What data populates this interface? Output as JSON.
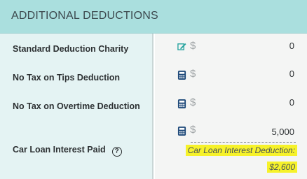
{
  "header": {
    "title": "ADDITIONAL DEDUCTIONS"
  },
  "rows": [
    {
      "label": "Standard Deduction Charity",
      "icon": "edit-icon",
      "currency": "$",
      "value": "0"
    },
    {
      "label": "No Tax on Tips Deduction",
      "icon": "calculator-icon",
      "currency": "$",
      "value": "0"
    },
    {
      "label": "No Tax on Overtime Deduction",
      "icon": "calculator-icon",
      "currency": "$",
      "value": "0"
    },
    {
      "label": "Car Loan Interest Paid",
      "icon": "calculator-icon",
      "currency": "$",
      "value": "5,000",
      "help": "?",
      "note_label": "Car Loan Interest Deduction:",
      "note_value": "$2,600"
    }
  ],
  "colors": {
    "header_bg": "#aadfde",
    "label_bg": "#e4f3f3",
    "highlight": "#f6f22a",
    "edit_icon": "#2aa5a0",
    "calc_icon": "#1f4a7a"
  }
}
